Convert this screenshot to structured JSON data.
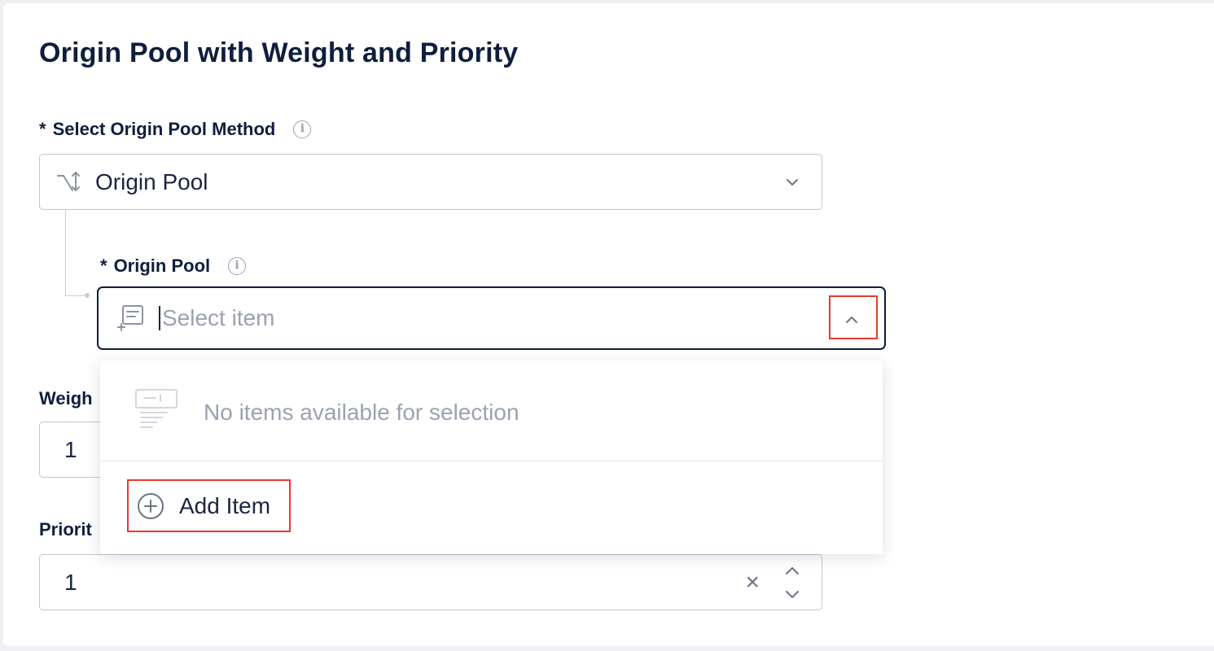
{
  "section": {
    "title": "Origin Pool with Weight and Priority"
  },
  "method_field": {
    "required_mark": "*",
    "label": "Select Origin Pool Method",
    "value": "Origin Pool"
  },
  "origin_pool_field": {
    "required_mark": "*",
    "label": "Origin Pool",
    "placeholder": "Select item"
  },
  "dropdown": {
    "empty_text": "No items available for selection",
    "add_item_label": "Add Item"
  },
  "weight_field": {
    "label_visible": "Weigh",
    "value": "1"
  },
  "priority_field": {
    "label_visible": "Priorit",
    "value": "1",
    "clear_glyph": "×"
  },
  "colors": {
    "highlight": "#e53b2c",
    "text_dark": "#0f1e3d",
    "muted": "#9aa2b1",
    "border": "#bfc5cf"
  },
  "icons": {
    "info": "info-icon",
    "method": "route-switch-icon",
    "pool": "list-add-icon",
    "collapse": "chevron-up-icon",
    "expand": "chevron-down-icon",
    "empty": "empty-list-icon",
    "add": "plus-circle-icon",
    "clear": "clear-icon",
    "stepper": "stepper-icon"
  }
}
